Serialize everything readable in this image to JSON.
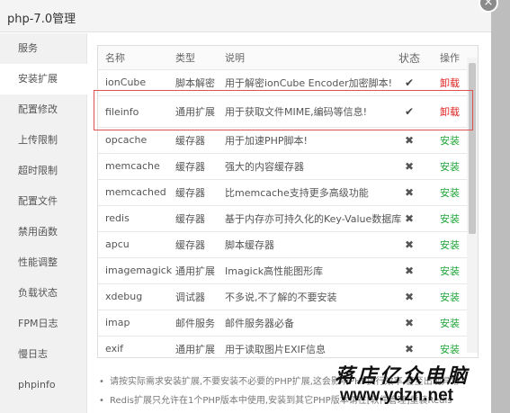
{
  "window": {
    "title": "php-7.0管理",
    "close_glyph": "×"
  },
  "sidebar": {
    "items": [
      {
        "label": "服务",
        "active": false
      },
      {
        "label": "安装扩展",
        "active": true
      },
      {
        "label": "配置修改",
        "active": false
      },
      {
        "label": "上传限制",
        "active": false
      },
      {
        "label": "超时限制",
        "active": false
      },
      {
        "label": "配置文件",
        "active": false
      },
      {
        "label": "禁用函数",
        "active": false
      },
      {
        "label": "性能调整",
        "active": false
      },
      {
        "label": "负载状态",
        "active": false
      },
      {
        "label": "FPM日志",
        "active": false
      },
      {
        "label": "慢日志",
        "active": false
      },
      {
        "label": "phpinfo",
        "active": false
      }
    ]
  },
  "table": {
    "headers": {
      "name": "名称",
      "type": "类型",
      "desc": "说明",
      "status": "状态",
      "op": "操作"
    },
    "rows": [
      {
        "name": "ionCube",
        "type": "脚本解密",
        "desc": "用于解密ionCube Encoder加密脚本!",
        "status": "✔",
        "installed": true,
        "op": "卸载"
      },
      {
        "name": "fileinfo",
        "type": "通用扩展",
        "desc": "用于获取文件MIME,编码等信息!",
        "status": "✔",
        "installed": true,
        "op": "卸载"
      },
      {
        "name": "opcache",
        "type": "缓存器",
        "desc": "用于加速PHP脚本!",
        "status": "✖",
        "installed": false,
        "op": "安装"
      },
      {
        "name": "memcache",
        "type": "缓存器",
        "desc": "强大的内容缓存器",
        "status": "✖",
        "installed": false,
        "op": "安装"
      },
      {
        "name": "memcached",
        "type": "缓存器",
        "desc": "比memcache支持更多高级功能",
        "status": "✖",
        "installed": false,
        "op": "安装"
      },
      {
        "name": "redis",
        "type": "缓存器",
        "desc": "基于内存亦可持久化的Key-Value数据库",
        "status": "✖",
        "installed": false,
        "op": "安装"
      },
      {
        "name": "apcu",
        "type": "缓存器",
        "desc": "脚本缓存器",
        "status": "✖",
        "installed": false,
        "op": "安装"
      },
      {
        "name": "imagemagick",
        "type": "通用扩展",
        "desc": "Imagick高性能图形库",
        "status": "✖",
        "installed": false,
        "op": "安装"
      },
      {
        "name": "xdebug",
        "type": "调试器",
        "desc": "不多说,不了解的不要安装",
        "status": "✖",
        "installed": false,
        "op": "安装"
      },
      {
        "name": "imap",
        "type": "邮件服务",
        "desc": "邮件服务器必备",
        "status": "✖",
        "installed": false,
        "op": "安装"
      },
      {
        "name": "exif",
        "type": "通用扩展",
        "desc": "用于读取图片EXIF信息",
        "status": "✖",
        "installed": false,
        "op": "安装"
      }
    ]
  },
  "notes": [
    "请按实际需求安装扩展,不要安装不必要的PHP扩展,这会影响PHP执行效率,甚至出现异常",
    "Redis扩展只允许在1个PHP版本中使用,安装到其它PHP版本请在[软件管理]重装Redis"
  ],
  "watermark": {
    "brand": "蒋店亿众电脑",
    "url": "www.ydzn.net"
  },
  "colors": {
    "install": "#20a53a",
    "uninstall": "#e02020",
    "highlight": "#e05050"
  }
}
